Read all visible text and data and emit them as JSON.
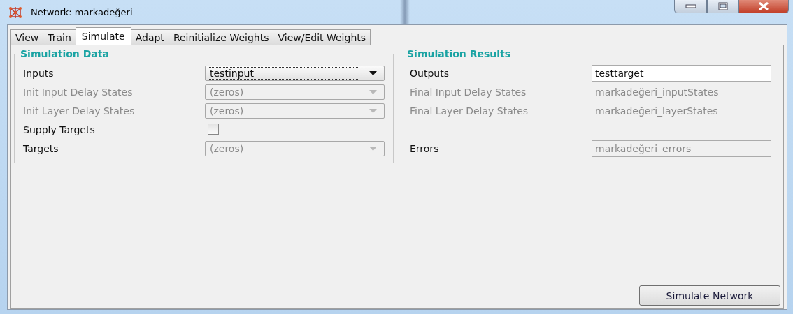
{
  "window": {
    "title": "Network: markadeğeri"
  },
  "tabs": [
    {
      "label": "View",
      "selected": false
    },
    {
      "label": "Train",
      "selected": false
    },
    {
      "label": "Simulate",
      "selected": true
    },
    {
      "label": "Adapt",
      "selected": false
    },
    {
      "label": "Reinitialize Weights",
      "selected": false
    },
    {
      "label": "View/Edit Weights",
      "selected": false
    }
  ],
  "simulation_data": {
    "title": "Simulation Data",
    "rows": [
      {
        "kind": "dropdown",
        "label": "Inputs",
        "value": "testinput",
        "label_disabled": false,
        "disabled": false,
        "focused": true
      },
      {
        "kind": "dropdown",
        "label": "Init Input Delay States",
        "value": "(zeros)",
        "label_disabled": true,
        "disabled": true,
        "focused": false
      },
      {
        "kind": "dropdown",
        "label": "Init Layer Delay States",
        "value": "(zeros)",
        "label_disabled": true,
        "disabled": true,
        "focused": false
      },
      {
        "kind": "checkbox",
        "label": "Supply Targets",
        "checked": false,
        "label_disabled": false,
        "disabled": false
      },
      {
        "kind": "dropdown",
        "label": "Targets",
        "value": "(zeros)",
        "label_disabled": false,
        "disabled": true,
        "focused": false
      }
    ]
  },
  "simulation_results": {
    "title": "Simulation Results",
    "rows": [
      {
        "label": "Outputs",
        "value": "testtarget",
        "label_disabled": false,
        "disabled": false
      },
      {
        "label": "Final Input Delay States",
        "value": "markadeğeri_inputStates",
        "label_disabled": true,
        "disabled": true
      },
      {
        "label": "Final Layer Delay States",
        "value": "markadeğeri_layerStates",
        "label_disabled": true,
        "disabled": true
      },
      {
        "label": "Errors",
        "value": "markadeğeri_errors",
        "label_disabled": false,
        "disabled": true
      }
    ]
  },
  "action_button": {
    "label": "Simulate Network"
  }
}
